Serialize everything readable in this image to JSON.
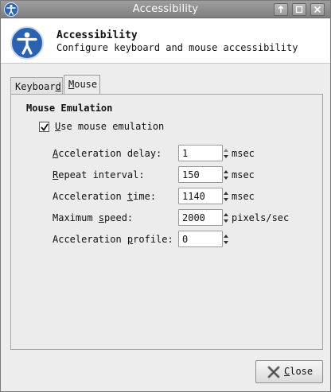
{
  "window": {
    "title": "Accessibility",
    "buttons": [
      "up-icon",
      "maximize-icon",
      "close-icon"
    ]
  },
  "header": {
    "title": "Accessibility",
    "subtitle": "Configure keyboard and mouse accessibility",
    "icon": "accessibility-icon"
  },
  "tabs": {
    "keyboard": {
      "pre": "Keyboar",
      "u": "d",
      "post": ""
    },
    "mouse": {
      "pre": "",
      "u": "M",
      "post": "ouse"
    }
  },
  "mouse_panel": {
    "section_title": "Mouse Emulation",
    "emulation": {
      "u": "U",
      "rest": "se mouse emulation",
      "checked": true
    },
    "fields": [
      {
        "u": "A",
        "rest": "cceleration delay:",
        "value": "1",
        "unit": "msec"
      },
      {
        "pre": "",
        "u": "R",
        "rest": "epeat interval:",
        "value": "150",
        "unit": "msec"
      },
      {
        "pre": "Acceleration ",
        "u": "t",
        "rest": "ime:",
        "value": "1140",
        "unit": "msec"
      },
      {
        "pre": "Maximum ",
        "u": "s",
        "rest": "peed:",
        "value": "2000",
        "unit": "pixels/sec"
      },
      {
        "pre": "Acceleration ",
        "u": "p",
        "rest": "rofile:",
        "value": "0",
        "unit": ""
      }
    ]
  },
  "footer": {
    "close": {
      "u": "C",
      "rest": "lose"
    }
  },
  "colors": {
    "titlebar": "#8e8e8e",
    "accent": "#2a62b0"
  }
}
